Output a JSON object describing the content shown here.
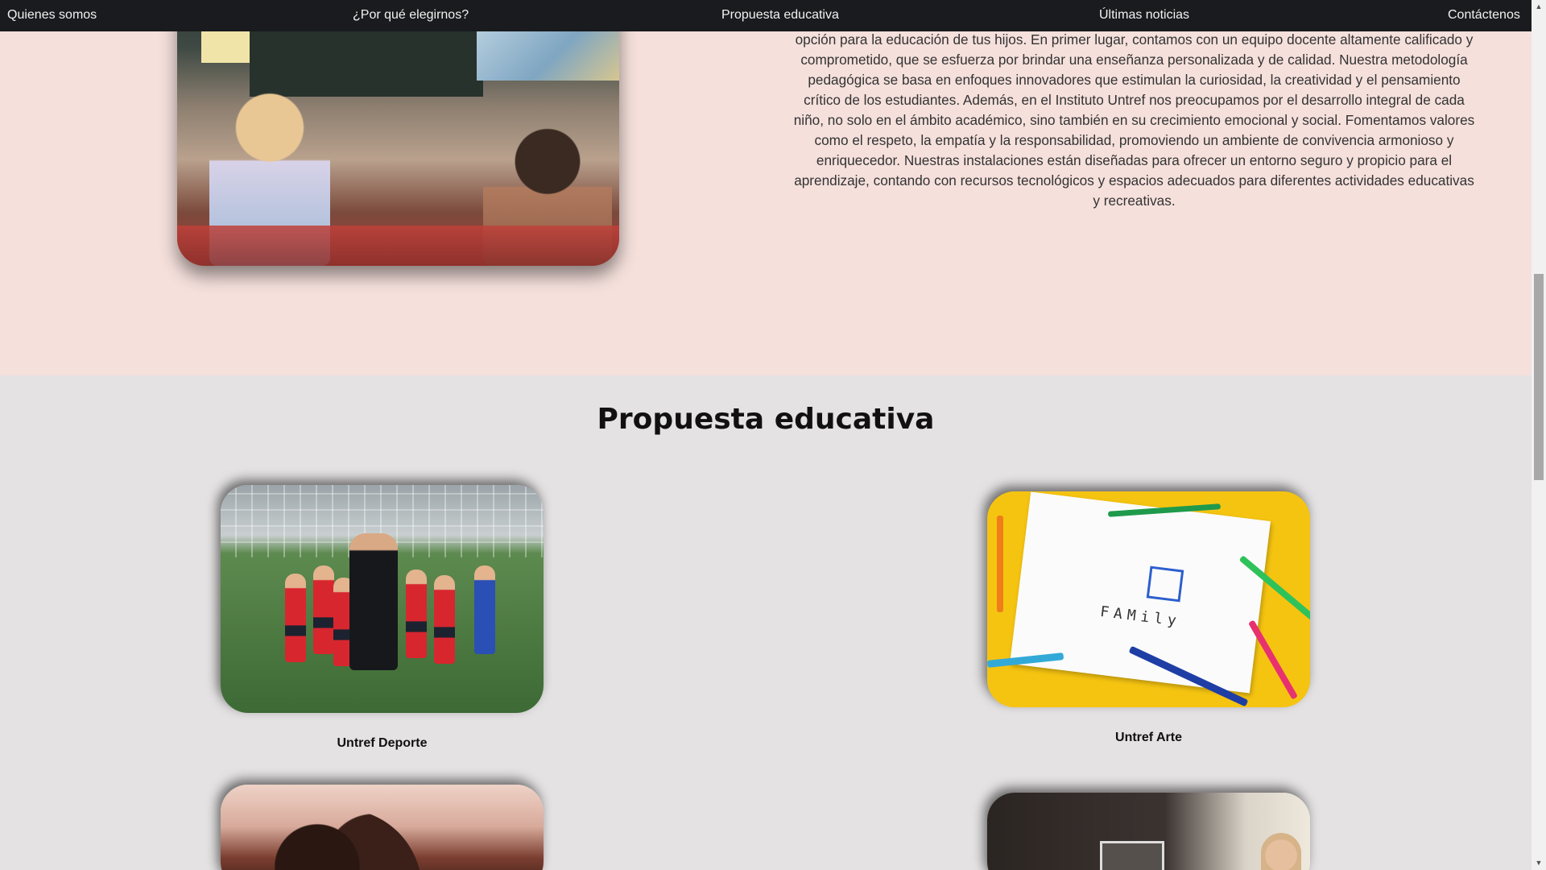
{
  "nav": {
    "items": [
      {
        "label": "Quienes somos"
      },
      {
        "label": "¿Por qué elegirnos?"
      },
      {
        "label": "Propuesta educativa"
      },
      {
        "label": "Últimas noticias"
      },
      {
        "label": "Contáctenos"
      }
    ]
  },
  "why_section": {
    "text": "opción para la educación de tus hijos. En primer lugar, contamos con un equipo docente altamente calificado y comprometido, que se esfuerza por brindar una enseñanza personalizada y de calidad. Nuestra metodología pedagógica se basa en enfoques innovadores que estimulan la curiosidad, la creatividad y el pensamiento crítico de los estudiantes. Además, en el Instituto Untref nos preocupamos por el desarrollo integral de cada niño, no solo en el ámbito académico, sino también en su crecimiento emocional y social. Fomentamos valores como el respeto, la empatía y la responsabilidad, promoviendo un ambiente de convivencia armonioso y enriquecedor. Nuestras instalaciones están diseñadas para ofrecer un entorno seguro y propicio para el aprendizaje, contando con recursos tecnológicos y espacios adecuados para diferentes actividades educativas y recreativas."
  },
  "proposal_section": {
    "title": "Propuesta educativa",
    "cards": [
      {
        "label": "Untref Deporte"
      },
      {
        "label": "Untref Arte"
      }
    ]
  },
  "art_image_text": "FAMily",
  "colors": {
    "nav_bg": "#191b1e",
    "pink_section_bg": "#f5e0dc",
    "gray_section_bg": "#e4e2e2"
  }
}
